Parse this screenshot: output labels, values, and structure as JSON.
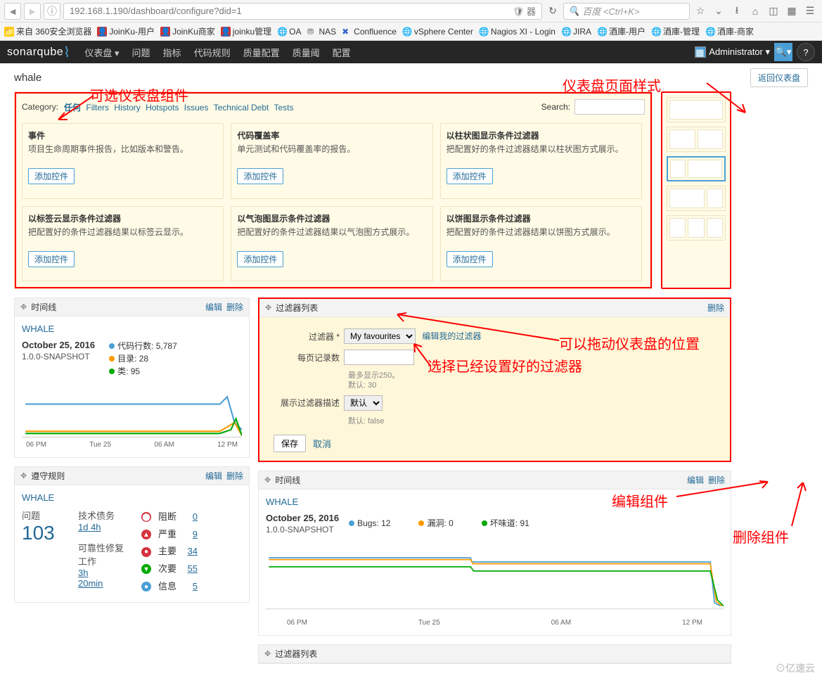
{
  "browser": {
    "url": "192.168.1.190/dashboard/configure?did=1",
    "shield_text": "器",
    "search_placeholder": "百度 <Ctrl+K>"
  },
  "bookmarks": {
    "origin_label": "来自 360安全浏览器",
    "items": [
      "JoinKu-用户",
      "JoinKu商家",
      "joinku管理",
      "OA",
      "NAS",
      "Confluence",
      "vSphere Center",
      "Nagios XI - Login",
      "JIRA",
      "酒庫-用户",
      "酒庫-管理",
      "酒庫-商家"
    ]
  },
  "sonarqube": {
    "logo_a": "sonar",
    "logo_b": "qube",
    "nav": [
      "仪表盘 ▾",
      "问题",
      "指标",
      "代码规则",
      "质量配置",
      "质量阈",
      "配置"
    ],
    "user": "Administrator ▾"
  },
  "project": {
    "name": "whale",
    "back_btn": "返回仪表盘"
  },
  "widget_selector": {
    "cat_label": "Category:",
    "cats": [
      "任何",
      "Filters",
      "History",
      "Hotspots",
      "Issues",
      "Technical Debt",
      "Tests"
    ],
    "search_label": "Search:",
    "add_label": "添加控件",
    "widgets": [
      {
        "t": "事件",
        "d": "项目生命周期事件报告，比如版本和警告。"
      },
      {
        "t": "代码覆盖率",
        "d": "单元测试和代码覆盖率的报告。"
      },
      {
        "t": "以柱状图显示条件过滤器",
        "d": "把配置好的条件过滤器结果以柱状图方式展示。"
      },
      {
        "t": "以标签云显示条件过滤器",
        "d": "把配置好的条件过滤器结果以标签云显示。"
      },
      {
        "t": "以气泡图显示条件过滤器",
        "d": "把配置好的条件过滤器结果以气泡图方式展示。"
      },
      {
        "t": "以饼图显示条件过滤器",
        "d": "把配置好的条件过滤器结果以饼图方式展示。"
      }
    ]
  },
  "timeline_widget": {
    "title": "时间线",
    "edit": "编辑",
    "del": "删除",
    "project": "WHALE",
    "date": "October 25, 2016",
    "snapshot": "1.0.0-SNAPSHOT",
    "legend": [
      {
        "c": "#4b9fd5",
        "t": "代码行数: 5,787"
      },
      {
        "c": "#f90",
        "t": "目录: 28"
      },
      {
        "c": "#0a0",
        "t": "类: 95"
      }
    ],
    "xaxis": [
      "06 PM",
      "Tue 25",
      "06 AM",
      "12 PM"
    ]
  },
  "filter_list_widget": {
    "title": "过滤器列表",
    "del": "删除",
    "labels": {
      "filter": "过滤器 *",
      "filter_val": "My favourites",
      "edit_link": "编辑我的过滤器",
      "page_size": "每页记录数",
      "hint1a": "最多显示250。",
      "hint1b": "默认: 30",
      "show_desc": "展示过滤器描述",
      "desc_val": "默认",
      "hint2": "默认: false",
      "save": "保存",
      "cancel": "取消"
    }
  },
  "rules_widget": {
    "title": "遵守规则",
    "edit": "编辑",
    "del": "删除",
    "project": "WHALE",
    "issues_label": "问题",
    "issues_val": "103",
    "debt_label": "技术债务",
    "debt_val": "1d 4h",
    "rel_label": "可靠性修复工作",
    "rel_val1": "3h",
    "rel_val2": "20min",
    "severities": [
      {
        "c": "#d4333f",
        "t": "阻断",
        "v": "0"
      },
      {
        "c": "#d4333f",
        "t": "严重",
        "v": "9"
      },
      {
        "c": "#d4333f",
        "t": "主要",
        "v": "34"
      },
      {
        "c": "#0a0",
        "t": "次要",
        "v": "55"
      },
      {
        "c": "#4b9fd5",
        "t": "信息",
        "v": "5"
      }
    ]
  },
  "big_timeline": {
    "title": "时间线",
    "edit": "编辑",
    "del": "删除",
    "project": "WHALE",
    "date": "October 25, 2016",
    "snapshot": "1.0.0-SNAPSHOT",
    "legend": [
      {
        "c": "#4b9fd5",
        "t": "Bugs: 12"
      },
      {
        "c": "#f90",
        "t": "漏洞: 0"
      },
      {
        "c": "#0a0",
        "t": "坏味道: 91"
      }
    ],
    "xaxis": [
      "06 PM",
      "Tue 25",
      "06 AM",
      "12 PM"
    ]
  },
  "filter_list2": {
    "title": "过滤器列表"
  },
  "annotations": {
    "a1": "可选仪表盘组件",
    "a2": "仪表盘页面样式",
    "a3": "可以拖动仪表盘的位置",
    "a4": "选择已经设置好的过滤器",
    "a5": "编辑组件",
    "a6": "删除组件"
  },
  "watermark": "⊙亿速云"
}
